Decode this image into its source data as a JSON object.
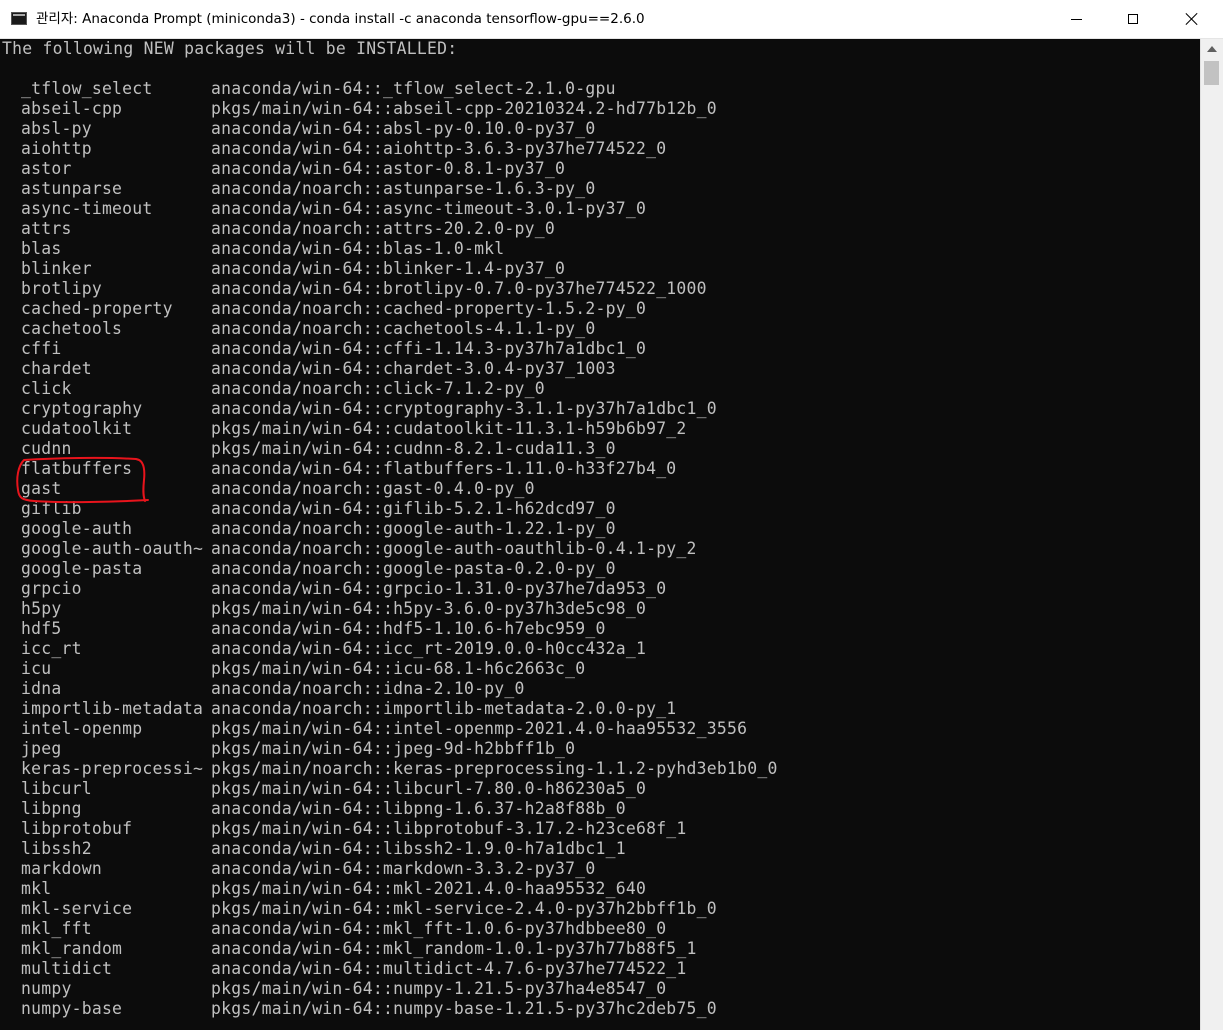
{
  "window": {
    "title": "관리자: Anaconda Prompt (miniconda3) - conda  install -c anaconda tensorflow-gpu==2.6.0",
    "controls": {
      "minimize": "minimize",
      "maximize": "maximize",
      "close": "close"
    }
  },
  "console": {
    "header": "The following NEW packages will be INSTALLED:",
    "packages": [
      {
        "name": "_tflow_select",
        "spec": "anaconda/win-64::_tflow_select-2.1.0-gpu"
      },
      {
        "name": "abseil-cpp",
        "spec": "pkgs/main/win-64::abseil-cpp-20210324.2-hd77b12b_0"
      },
      {
        "name": "absl-py",
        "spec": "anaconda/win-64::absl-py-0.10.0-py37_0"
      },
      {
        "name": "aiohttp",
        "spec": "anaconda/win-64::aiohttp-3.6.3-py37he774522_0"
      },
      {
        "name": "astor",
        "spec": "anaconda/win-64::astor-0.8.1-py37_0"
      },
      {
        "name": "astunparse",
        "spec": "anaconda/noarch::astunparse-1.6.3-py_0"
      },
      {
        "name": "async-timeout",
        "spec": "anaconda/win-64::async-timeout-3.0.1-py37_0"
      },
      {
        "name": "attrs",
        "spec": "anaconda/noarch::attrs-20.2.0-py_0"
      },
      {
        "name": "blas",
        "spec": "anaconda/win-64::blas-1.0-mkl"
      },
      {
        "name": "blinker",
        "spec": "anaconda/win-64::blinker-1.4-py37_0"
      },
      {
        "name": "brotlipy",
        "spec": "anaconda/win-64::brotlipy-0.7.0-py37he774522_1000"
      },
      {
        "name": "cached-property",
        "spec": "anaconda/noarch::cached-property-1.5.2-py_0"
      },
      {
        "name": "cachetools",
        "spec": "anaconda/noarch::cachetools-4.1.1-py_0"
      },
      {
        "name": "cffi",
        "spec": "anaconda/win-64::cffi-1.14.3-py37h7a1dbc1_0"
      },
      {
        "name": "chardet",
        "spec": "anaconda/win-64::chardet-3.0.4-py37_1003"
      },
      {
        "name": "click",
        "spec": "anaconda/noarch::click-7.1.2-py_0"
      },
      {
        "name": "cryptography",
        "spec": "anaconda/win-64::cryptography-3.1.1-py37h7a1dbc1_0"
      },
      {
        "name": "cudatoolkit",
        "spec": "pkgs/main/win-64::cudatoolkit-11.3.1-h59b6b97_2"
      },
      {
        "name": "cudnn",
        "spec": "pkgs/main/win-64::cudnn-8.2.1-cuda11.3_0"
      },
      {
        "name": "flatbuffers",
        "spec": "anaconda/win-64::flatbuffers-1.11.0-h33f27b4_0"
      },
      {
        "name": "gast",
        "spec": "anaconda/noarch::gast-0.4.0-py_0"
      },
      {
        "name": "giflib",
        "spec": "anaconda/win-64::giflib-5.2.1-h62dcd97_0"
      },
      {
        "name": "google-auth",
        "spec": "anaconda/noarch::google-auth-1.22.1-py_0"
      },
      {
        "name": "google-auth-oauth~",
        "spec": "anaconda/noarch::google-auth-oauthlib-0.4.1-py_2"
      },
      {
        "name": "google-pasta",
        "spec": "anaconda/noarch::google-pasta-0.2.0-py_0"
      },
      {
        "name": "grpcio",
        "spec": "anaconda/win-64::grpcio-1.31.0-py37he7da953_0"
      },
      {
        "name": "h5py",
        "spec": "pkgs/main/win-64::h5py-3.6.0-py37h3de5c98_0"
      },
      {
        "name": "hdf5",
        "spec": "anaconda/win-64::hdf5-1.10.6-h7ebc959_0"
      },
      {
        "name": "icc_rt",
        "spec": "anaconda/win-64::icc_rt-2019.0.0-h0cc432a_1"
      },
      {
        "name": "icu",
        "spec": "pkgs/main/win-64::icu-68.1-h6c2663c_0"
      },
      {
        "name": "idna",
        "spec": "anaconda/noarch::idna-2.10-py_0"
      },
      {
        "name": "importlib-metadata",
        "spec": "anaconda/noarch::importlib-metadata-2.0.0-py_1"
      },
      {
        "name": "intel-openmp",
        "spec": "pkgs/main/win-64::intel-openmp-2021.4.0-haa95532_3556"
      },
      {
        "name": "jpeg",
        "spec": "pkgs/main/win-64::jpeg-9d-h2bbff1b_0"
      },
      {
        "name": "keras-preprocessi~",
        "spec": "pkgs/main/noarch::keras-preprocessing-1.1.2-pyhd3eb1b0_0"
      },
      {
        "name": "libcurl",
        "spec": "pkgs/main/win-64::libcurl-7.80.0-h86230a5_0"
      },
      {
        "name": "libpng",
        "spec": "anaconda/win-64::libpng-1.6.37-h2a8f88b_0"
      },
      {
        "name": "libprotobuf",
        "spec": "pkgs/main/win-64::libprotobuf-3.17.2-h23ce68f_1"
      },
      {
        "name": "libssh2",
        "spec": "anaconda/win-64::libssh2-1.9.0-h7a1dbc1_1"
      },
      {
        "name": "markdown",
        "spec": "anaconda/win-64::markdown-3.3.2-py37_0"
      },
      {
        "name": "mkl",
        "spec": "pkgs/main/win-64::mkl-2021.4.0-haa95532_640"
      },
      {
        "name": "mkl-service",
        "spec": "pkgs/main/win-64::mkl-service-2.4.0-py37h2bbff1b_0"
      },
      {
        "name": "mkl_fft",
        "spec": "anaconda/win-64::mkl_fft-1.0.6-py37hdbbee80_0"
      },
      {
        "name": "mkl_random",
        "spec": "anaconda/win-64::mkl_random-1.0.1-py37h77b88f5_1"
      },
      {
        "name": "multidict",
        "spec": "anaconda/win-64::multidict-4.7.6-py37he774522_1"
      },
      {
        "name": "numpy",
        "spec": "pkgs/main/win-64::numpy-1.21.5-py37ha4e8547_0"
      },
      {
        "name": "numpy-base",
        "spec": "pkgs/main/win-64::numpy-base-1.21.5-py37hc2deb75_0"
      }
    ]
  },
  "colors": {
    "console_bg": "#0c0c0c",
    "console_text": "#c0c0c0",
    "annotation": "#e8141c",
    "titlebar_bg": "#ffffff"
  },
  "icons": {
    "app": "console-window-icon",
    "minimize": "minimize-icon",
    "maximize": "maximize-icon",
    "close": "close-icon",
    "scroll_up": "arrow-up-icon"
  }
}
